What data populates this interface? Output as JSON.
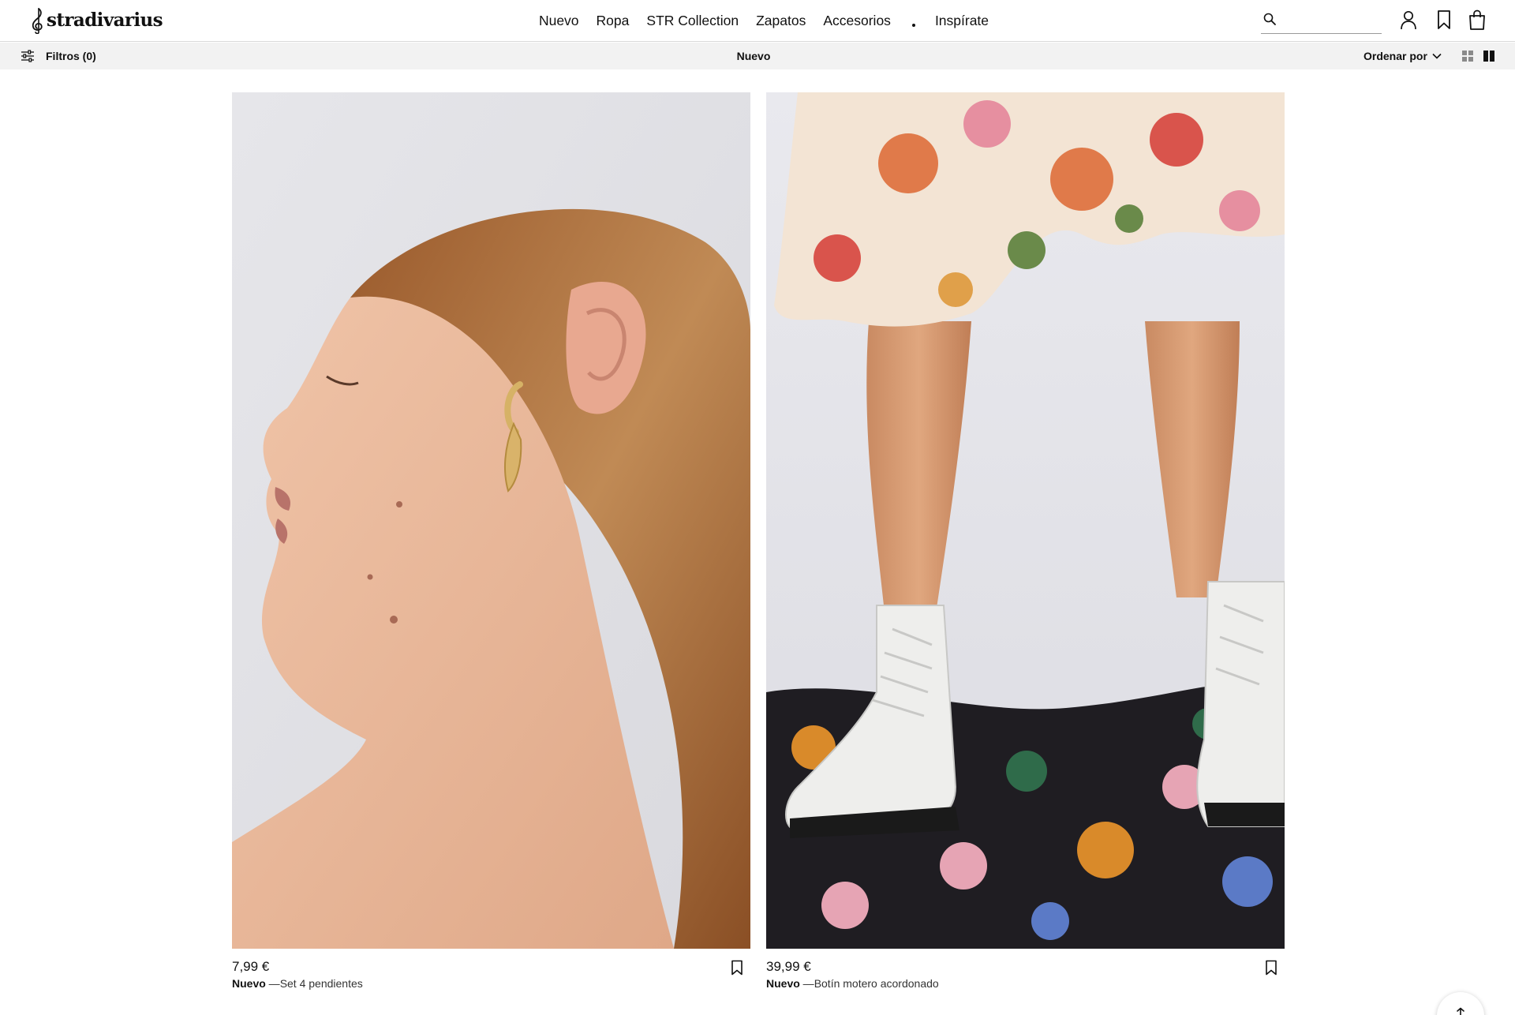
{
  "header": {
    "logo_text": "stradivarius",
    "nav": [
      {
        "label": "Nuevo"
      },
      {
        "label": "Ropa"
      },
      {
        "label": "STR Collection"
      },
      {
        "label": "Zapatos"
      },
      {
        "label": "Accesorios"
      },
      {
        "label": "Inspírate"
      }
    ],
    "search_value": "",
    "icons": [
      "search-icon",
      "account-icon",
      "wishlist-icon",
      "bag-icon"
    ]
  },
  "toolbar": {
    "filters_label": "Filtros (0)",
    "title": "Nuevo",
    "sort_label": "Ordenar por",
    "view_options": [
      "grid-4-view",
      "grid-2-view"
    ],
    "active_view": "grid-2-view"
  },
  "products": [
    {
      "price": "7,99 €",
      "tag": "Nuevo",
      "separator": " —",
      "name": "Set 4 pendientes",
      "image_icon": "earring-model-photo"
    },
    {
      "price": "39,99 €",
      "tag": "Nuevo",
      "separator": " —",
      "name": "Botín motero acordonado",
      "image_icon": "boots-model-photo"
    }
  ],
  "colors": {
    "text": "#111111",
    "toolbar_bg": "#f2f2f2",
    "border": "#d9d9d9"
  }
}
